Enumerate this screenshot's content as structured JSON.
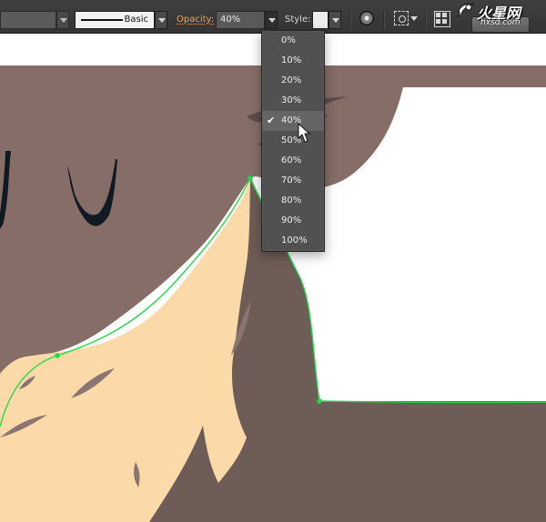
{
  "control_bar": {
    "stroke_profile_label": "Basic",
    "opacity_label": "Opacity:",
    "opacity_value": "40%",
    "style_label": "Style:"
  },
  "opacity_menu": {
    "options": [
      "0%",
      "10%",
      "20%",
      "30%",
      "40%",
      "50%",
      "60%",
      "70%",
      "80%",
      "90%",
      "100%"
    ],
    "selected": "40%",
    "checkmark": "✔"
  },
  "watermark": {
    "brand": "火星网",
    "url": "hxsd.com"
  },
  "colors": {
    "toolbar": "#3a3a3a",
    "opacity_label": "#f3a24d",
    "dropdown": "#515151",
    "highlight": "#656565",
    "background_shape": "#876d68",
    "lower_shape": "#6e5d57",
    "peach_shape": "#fbd9a8",
    "selection_path": "#22d94a",
    "dark_marks": "#0f1a22"
  }
}
